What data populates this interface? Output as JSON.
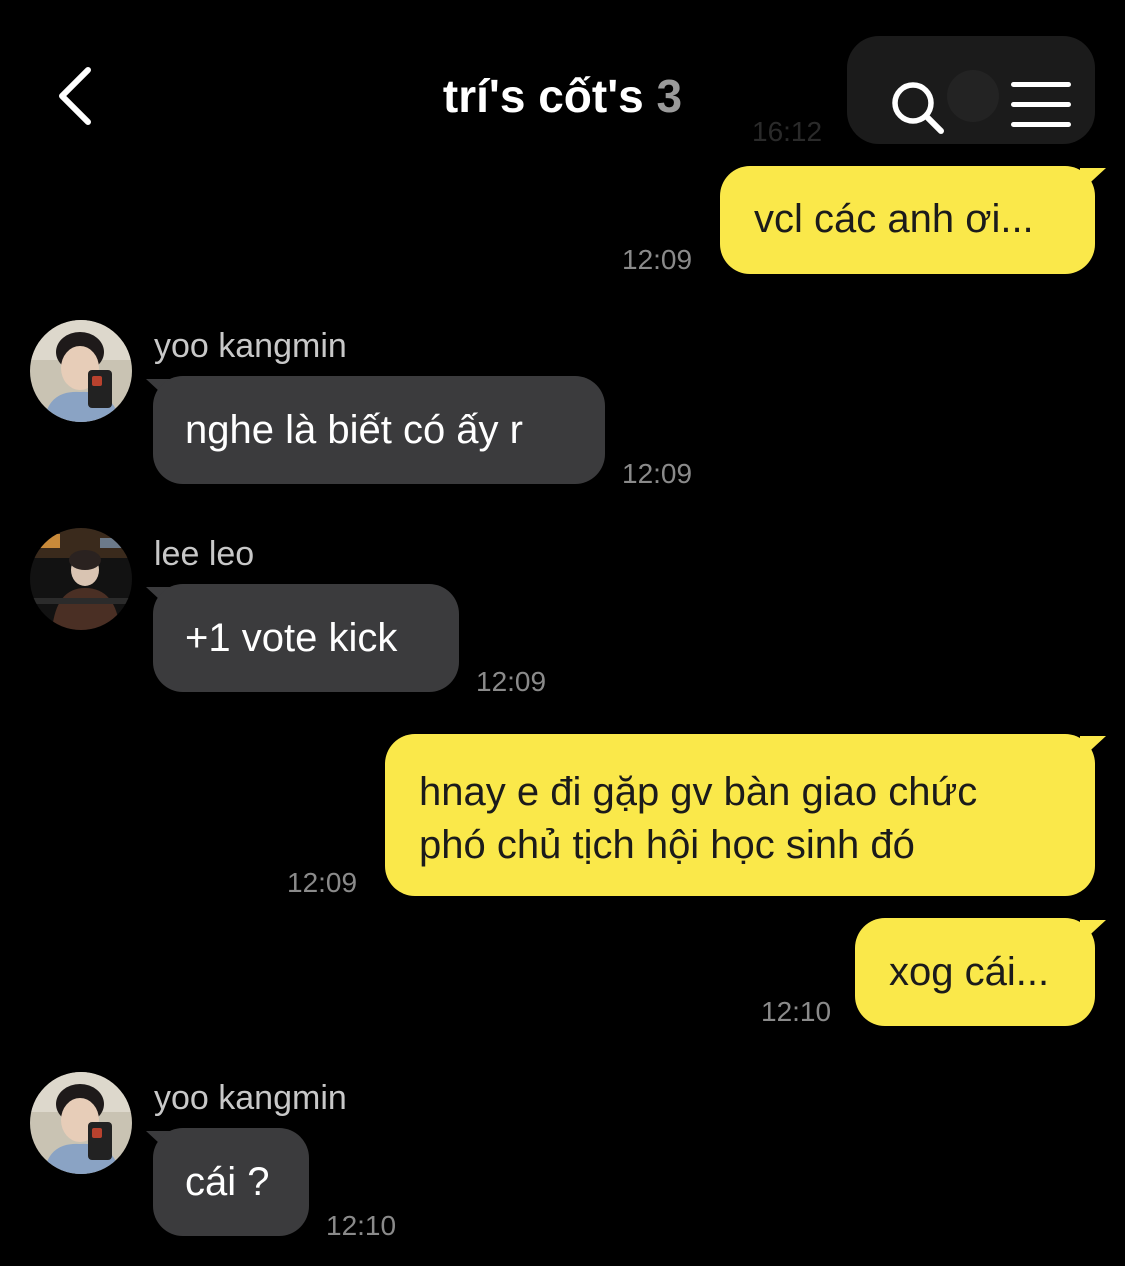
{
  "header": {
    "title": "trí's cốt's",
    "member_count": "3",
    "pinned_time": "16:12"
  },
  "messages": [
    {
      "sender": "me",
      "text": "vcl các anh ơi...",
      "time": "12:09"
    },
    {
      "sender": "yoo kangmin",
      "text": "nghe là biết có ấy r",
      "time": "12:09"
    },
    {
      "sender": "lee leo",
      "text": "+1 vote kick",
      "time": "12:09"
    },
    {
      "sender": "me",
      "text_line1": "hnay e đi gặp gv bàn giao chức",
      "text_line2": "phó chủ tịch hội học sinh đó",
      "time": "12:09"
    },
    {
      "sender": "me",
      "text": "xog cái...",
      "time": "12:10"
    },
    {
      "sender": "yoo kangmin",
      "text": "cái ?",
      "time": "12:10"
    }
  ],
  "colors": {
    "my_bubble": "#fae84a",
    "their_bubble": "#3b3b3d",
    "background": "#000000"
  },
  "icons": {
    "back": "chevron-left-icon",
    "search": "search-icon",
    "menu": "hamburger-menu-icon"
  }
}
